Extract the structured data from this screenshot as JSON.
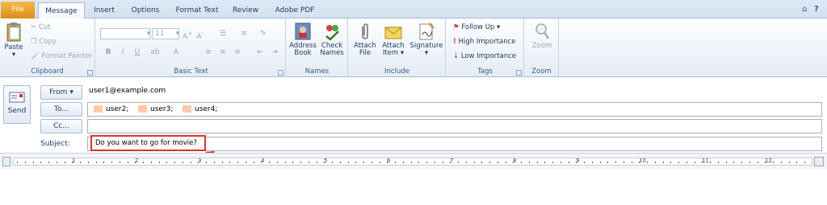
{
  "tabs": [
    "File",
    "Message",
    "Insert",
    "Options",
    "Format Text",
    "Review",
    "Adobe PDF"
  ],
  "clipboard": {
    "paste": "Paste",
    "cut": "Cut",
    "copy": "Copy",
    "format_painter": "Format Painter",
    "label": "Clipboard"
  },
  "basic_text": {
    "font_size": "11",
    "label": "Basic Text"
  },
  "names": {
    "address_book": [
      "Address",
      "Book"
    ],
    "check_names": [
      "Check",
      "Names"
    ],
    "label": "Names"
  },
  "include": {
    "attach_file": [
      "Attach",
      "File"
    ],
    "attach_item": [
      "Attach",
      "Item"
    ],
    "signature": "Signature",
    "label": "Include"
  },
  "tags": {
    "follow_up": "Follow Up",
    "high_importance": "High Importance",
    "low_importance": "Low Importance",
    "label": "Tags"
  },
  "zoom": {
    "zoom": "Zoom",
    "label": "Zoom"
  },
  "message": {
    "send": "Send",
    "from_label": "From",
    "from_value": "user1@example.com",
    "to_label": "To...",
    "cc_label": "Cc...",
    "recipients": [
      "user2;",
      "user3;",
      "user4;"
    ],
    "subject_label": "Subject:",
    "subject_value": "Do you want to go for movie?"
  },
  "ruler": {
    "numbers": [
      "1",
      "2",
      "3",
      "4",
      "5",
      "6",
      "7",
      "8",
      "9",
      "10",
      "11",
      "12"
    ]
  },
  "colors": {
    "file_tab": "#e08d16",
    "annotation": "#d9332b",
    "recipient_chip": "#f9caa7"
  }
}
